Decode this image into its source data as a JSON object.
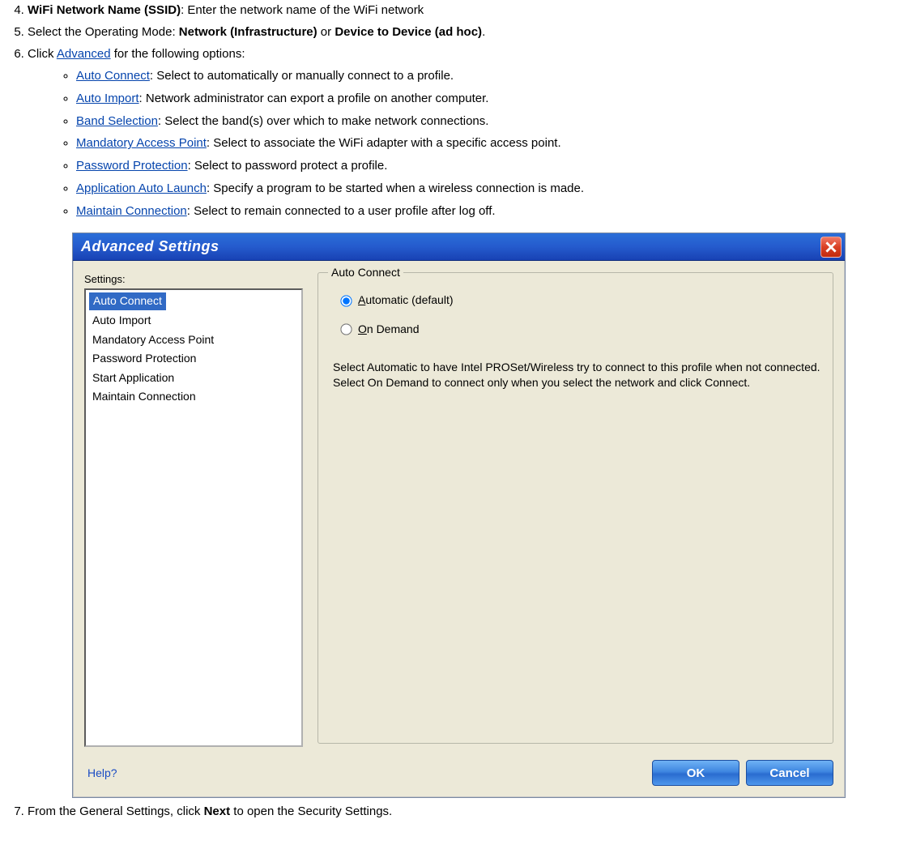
{
  "list_items": {
    "i4": {
      "num": "4.",
      "bold": "WiFi Network Name (SSID)",
      "rest": ": Enter the network name of the WiFi network"
    },
    "i5": {
      "num": "5.",
      "pre": "Select the Operating Mode: ",
      "b1": "Network (Infrastructure)",
      "mid": " or ",
      "b2": "Device to Device (ad hoc)",
      "post": "."
    },
    "i6": {
      "num": "6.",
      "pre": "Click ",
      "link": "Advanced",
      "post": " for the following options:"
    },
    "i7": {
      "num": "7.",
      "pre": "From the General Settings, click ",
      "b": "Next",
      "post": " to open the Security Settings."
    }
  },
  "sublist": [
    {
      "link": "Auto Connect",
      "desc": ": Select to automatically or manually connect to a profile."
    },
    {
      "link": "Auto Import",
      "desc": ": Network administrator can export a profile on another computer."
    },
    {
      "link": "Band Selection",
      "desc": ": Select the band(s) over which to make network connections."
    },
    {
      "link": "Mandatory Access Point",
      "desc": ": Select to associate the WiFi adapter with a specific access point."
    },
    {
      "link": "Password Protection",
      "desc": ": Select to password protect a profile."
    },
    {
      "link": "Application Auto Launch",
      "desc": ": Specify a program to be started when a wireless connection is made."
    },
    {
      "link": "Maintain Connection",
      "desc": ": Select to remain connected to a user profile after log off."
    }
  ],
  "dialog": {
    "title": "Advanced Settings",
    "settings_label": "Settings:",
    "settings_items": [
      {
        "label": "Auto Connect",
        "selected": true
      },
      {
        "label": "Auto Import",
        "selected": false
      },
      {
        "label": "Mandatory Access Point",
        "selected": false
      },
      {
        "label": "Password Protection",
        "selected": false
      },
      {
        "label": "Start Application",
        "selected": false
      },
      {
        "label": "Maintain Connection",
        "selected": false
      }
    ],
    "group_title": "Auto Connect",
    "radio1_u": "A",
    "radio1_rest": "utomatic (default)",
    "radio2_u": "O",
    "radio2_rest": "n Demand",
    "radio1_checked": true,
    "description": "Select Automatic to have Intel PROSet/Wireless try to connect to this profile when not connected. Select On Demand to connect only when you select the network and click Connect.",
    "help": "Help?",
    "ok": "OK",
    "cancel": "Cancel"
  }
}
